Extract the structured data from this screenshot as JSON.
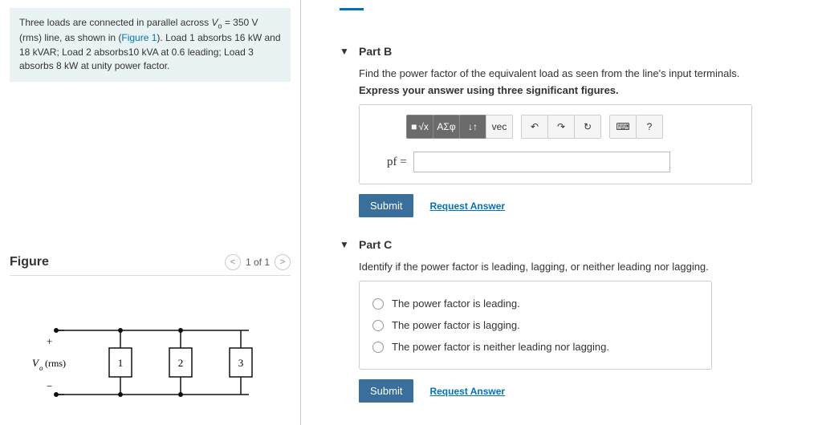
{
  "problem": {
    "text_html": "Three loads are connected in parallel across <i>V</i><sub>o</sub> = 350 V (rms) line, as shown in (<a>Figure 1</a>). Load 1 absorbs 16 kW and 18 kVAR; Load 2 absorbs10 kVA at 0.6 leading; Load 3 absorbs 8 kW at unity power factor."
  },
  "figure": {
    "title": "Figure",
    "counter": "1 of 1",
    "source_label": "V",
    "source_sub": "o",
    "source_suffix": " (rms)",
    "blocks": [
      "1",
      "2",
      "3"
    ],
    "plus": "+",
    "minus": "−"
  },
  "partB": {
    "title": "Part B",
    "prompt1": "Find the power factor of the equivalent load as seen from the line's input terminals.",
    "prompt2": "Express your answer using three significant figures.",
    "toolbar": {
      "templates": "■",
      "sqrt": "√x",
      "greek": "ΑΣφ",
      "arrows": "↓↑",
      "vec": "vec",
      "undo": "↶",
      "redo": "↷",
      "reset": "↻",
      "keyboard": "⌨",
      "help": "?"
    },
    "answer_label": "pf =",
    "submit": "Submit",
    "request": "Request Answer"
  },
  "partC": {
    "title": "Part C",
    "prompt": "Identify if the power factor is leading, lagging, or neither leading nor lagging.",
    "options": [
      "The power factor is leading.",
      "The power factor is lagging.",
      "The power factor is neither leading nor lagging."
    ],
    "submit": "Submit",
    "request": "Request Answer"
  }
}
